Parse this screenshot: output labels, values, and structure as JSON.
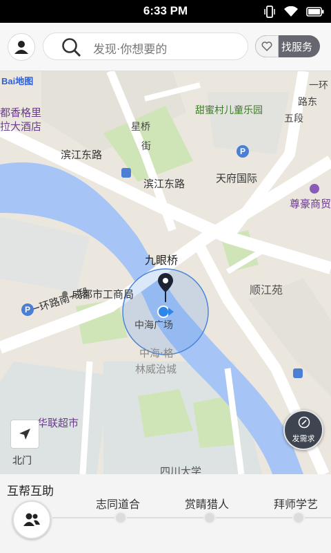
{
  "status_bar": {
    "time": "6:33 PM"
  },
  "top_bar": {
    "search_placeholder": "发现·你想要的",
    "service_button_label": "找服务"
  },
  "map": {
    "logo_prefix": "Bai",
    "logo_suffix": "地图",
    "labels": {
      "hotel_1": "都香格里",
      "hotel_2": "拉大酒店",
      "star_bridge_1": "星桥",
      "star_bridge_2": "街",
      "park": "甜蜜村儿童乐园",
      "ring_road_5_1": "一环",
      "ring_road_5_2": "路东",
      "ring_road_5_3": "五段",
      "binjiang_1": "滨江东路",
      "binjiang_2": "滨江东路",
      "tianfu": "天府国际",
      "zunhao": "尊豪商贸",
      "jiuyan_bridge": "九眼桥",
      "shunjiang": "顺江苑",
      "icb": "成都市工商局",
      "ring_road_1": "一环路南一段",
      "zhonghai_plaza": "中海广场",
      "zhonghai_ge_1": "中海·格",
      "zhonghai_ge_2": "林威治城",
      "supermarket": "华联超市",
      "sichuan_univ": "四川大学"
    },
    "north_label": "北门",
    "request_button_label": "发需求"
  },
  "bottom_panel": {
    "title": "互帮互助",
    "tabs": [
      "志同道合",
      "赏睛猎人",
      "拜师学艺"
    ]
  },
  "colors": {
    "water": "#a6c4f5",
    "road": "#ffffff",
    "green": "#cfe5b8",
    "block": "#dde3e2",
    "location_blue": "#2e86e8"
  }
}
